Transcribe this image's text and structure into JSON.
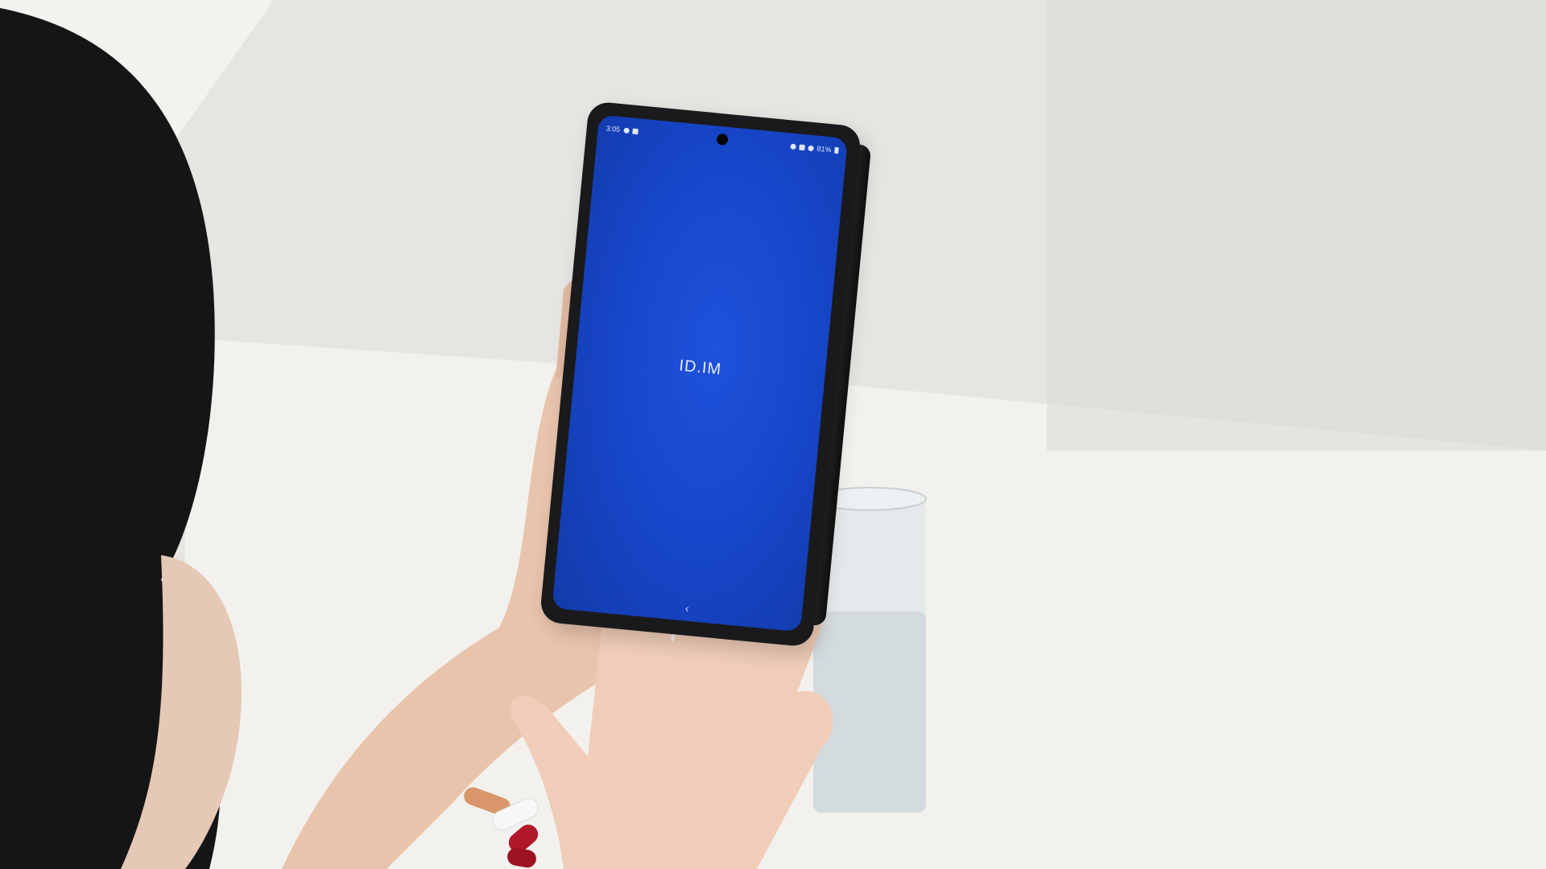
{
  "phone": {
    "status_bar": {
      "time": "3:05",
      "battery": "81%"
    },
    "app_title": "ID.IM",
    "nav_back_glyph": "‹"
  },
  "colors": {
    "screen_blue": "#1745c8",
    "wall": "#e9e8e4",
    "table": "#f1f0ee"
  },
  "icons": [
    "notification-icons",
    "camera-cutout",
    "volume-icon",
    "signal-icon",
    "alarm-icon",
    "battery-icon",
    "back-chevron-icon"
  ]
}
